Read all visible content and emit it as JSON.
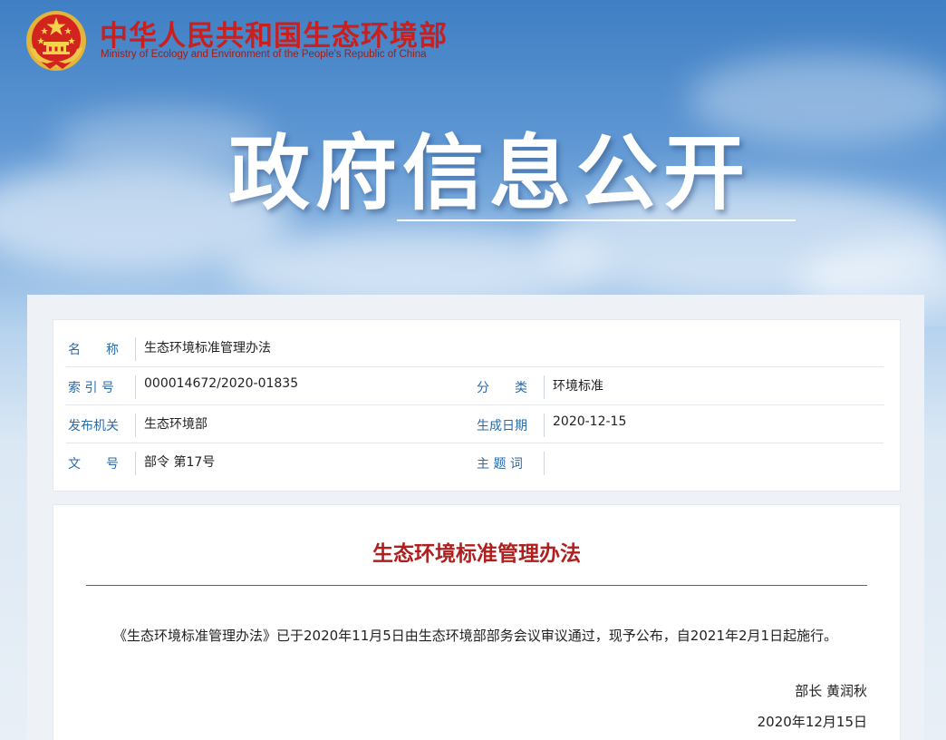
{
  "header": {
    "org_name_cn": "中华人民共和国生态环境部",
    "org_name_en": "Ministry of Ecology and Environment of the People's Republic of China",
    "logo_icon": "national-emblem-icon",
    "brand_color": "#c8201f"
  },
  "banner": {
    "title": "政府信息公开"
  },
  "meta": {
    "name_label": "名　　称",
    "name_value": "生态环境标准管理办法",
    "index_label": "索 引 号",
    "index_value": "000014672/2020-01835",
    "category_label": "分　　类",
    "category_value": "环境标准",
    "issuer_label": "发布机关",
    "issuer_value": "生态环境部",
    "date_label": "生成日期",
    "date_value": "2020-12-15",
    "doc_no_label": "文　　号",
    "doc_no_value": "部令 第17号",
    "keywords_label": "主 题 词",
    "keywords_value": "",
    "label_color": "#2c6aa8"
  },
  "document": {
    "title": "生态环境标准管理办法",
    "body": "《生态环境标准管理办法》已于2020年11月5日由生态环境部部务会议审议通过，现予公布，自2021年2月1日起施行。",
    "signature": "部长 黄润秋",
    "date": "2020年12月15日",
    "title_color": "#b01e1e"
  }
}
